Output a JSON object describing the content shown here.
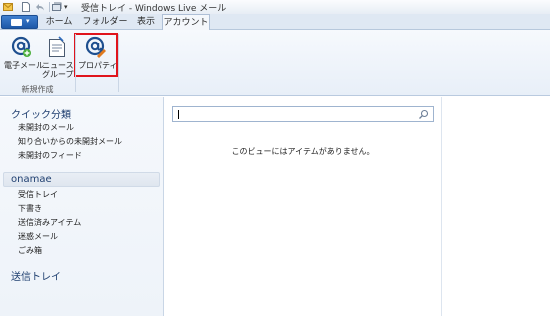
{
  "window": {
    "title": "受信トレイ - Windows Live メール"
  },
  "tabs": [
    {
      "label": "ホーム"
    },
    {
      "label": "フォルダー"
    },
    {
      "label": "表示"
    },
    {
      "label": "アカウント"
    }
  ],
  "ribbon": {
    "buttons": [
      {
        "label": "電子メール"
      },
      {
        "label": "ニュース\nグループ"
      },
      {
        "label": "プロパティ"
      }
    ],
    "group_label": "新規作成"
  },
  "nav": {
    "quick_views": {
      "header": "クイック分類",
      "items": [
        "未開封のメール",
        "知り合いからの未開封メール",
        "未開封のフィード"
      ]
    },
    "account": {
      "name": "onamae",
      "items": [
        "受信トレイ",
        "下書き",
        "送信済みアイテム",
        "迷惑メール",
        "ごみ箱"
      ]
    },
    "outbox": "送信トレイ"
  },
  "main": {
    "search": {
      "value": "",
      "placeholder": ""
    },
    "empty_message": "このビューにはアイテムがありません。"
  }
}
